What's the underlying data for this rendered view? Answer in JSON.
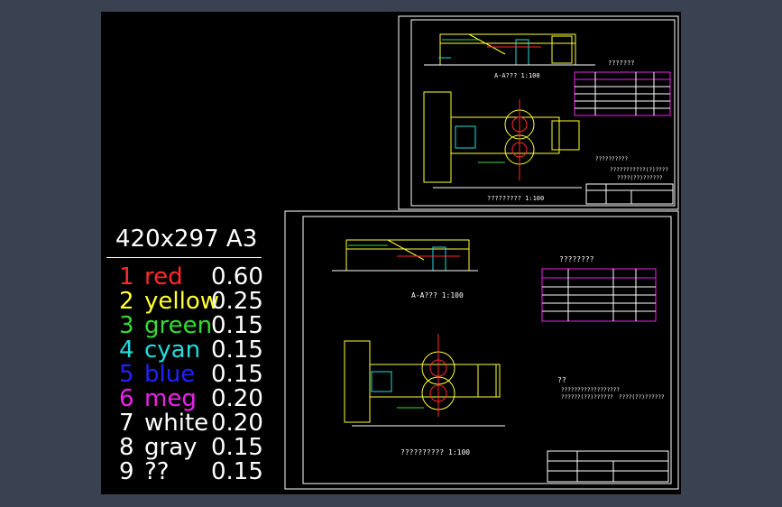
{
  "sheet_size_label": "420x297",
  "sheet_format_label": "A3",
  "pen_table": [
    {
      "num": "1",
      "name": "red",
      "width": "0.60",
      "color": "#ff2a2a"
    },
    {
      "num": "2",
      "name": "yellow",
      "width": "0.25",
      "color": "#ffff33"
    },
    {
      "num": "3",
      "name": "green",
      "width": "0.15",
      "color": "#33dd33"
    },
    {
      "num": "4",
      "name": "cyan",
      "width": "0.15",
      "color": "#22dddd"
    },
    {
      "num": "5",
      "name": "blue",
      "width": "0.15",
      "color": "#2222ff"
    },
    {
      "num": "6",
      "name": "meg",
      "width": "0.20",
      "color": "#ee22ee"
    },
    {
      "num": "7",
      "name": "white",
      "width": "0.20",
      "color": "#ffffff"
    },
    {
      "num": "8",
      "name": "gray",
      "width": "0.15",
      "color": "#ffffff"
    },
    {
      "num": "9",
      "name": "??",
      "width": "0.15",
      "color": "#ffffff"
    }
  ],
  "drawing_top": {
    "section_label": "A-A???",
    "section_scale": "1:100",
    "plan_label": "?????????",
    "plan_scale": "1:100",
    "table_title": "???????",
    "note_line1": "??????????",
    "note_line2": "???????????(?)????",
    "note_line3": "????(??)??????"
  },
  "drawing_bottom": {
    "section_label": "A-A???",
    "section_scale": "1:100",
    "plan_label": "??????????",
    "plan_scale": "1:100",
    "table_title": "????????",
    "note_title": "??",
    "note_line1": "??????????????????",
    "note_line2": "??????(??)??????",
    "note_line3": "????(??)??????"
  },
  "colors": {
    "background": "#3a4150",
    "canvas": "#000000",
    "frame": "#ffffff",
    "yellow": "#ffff33",
    "cyan": "#22dddd",
    "red": "#ff2a2a",
    "green": "#33dd33",
    "magenta": "#ee22ee"
  }
}
